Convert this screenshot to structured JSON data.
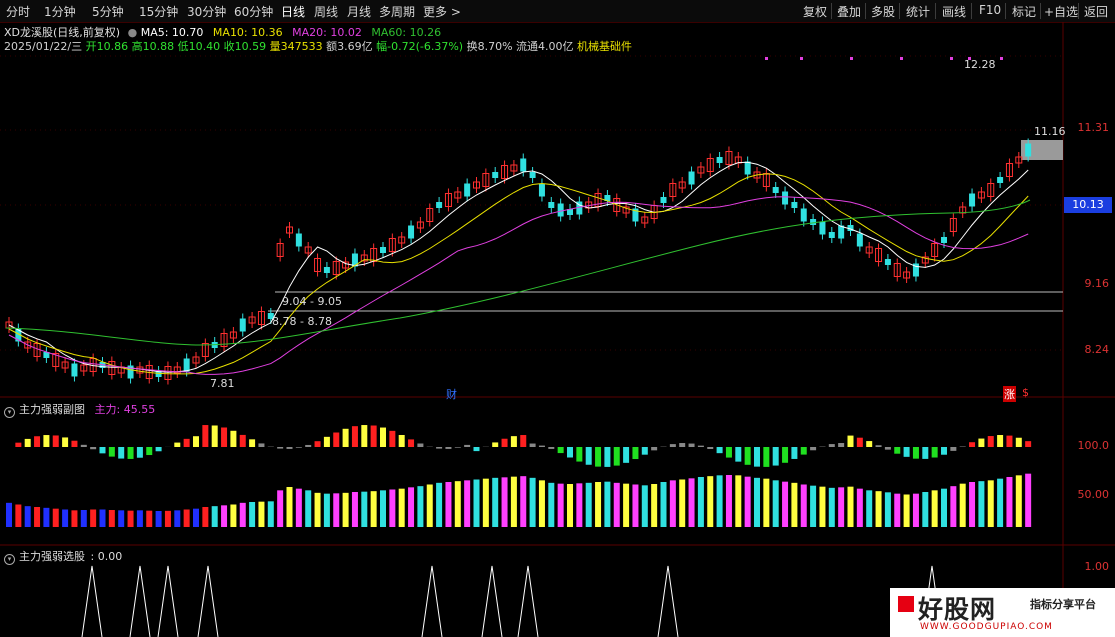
{
  "toolbar": {
    "left_items": [
      "分时",
      "1分钟",
      "5分钟",
      "15分钟",
      "30分钟",
      "60分钟",
      "日线",
      "周线",
      "月线",
      "多周期",
      "更多 >"
    ],
    "active": "日线",
    "right_items": [
      "复权",
      "叠加",
      "多股",
      "统计",
      "画线",
      "F10",
      "标记",
      "+自选",
      "返回"
    ]
  },
  "stock": {
    "title": "XD龙溪股(日线,前复权)",
    "ma5": "MA5: 10.70",
    "ma10": "MA10: 10.36",
    "ma20": "MA20: 10.02",
    "ma60": "MA60: 10.26",
    "date": "2025/01/22/三",
    "open": "开10.86",
    "high": "高10.88",
    "low": "低10.40",
    "close": "收10.59",
    "volume": "量347533",
    "amount": "额3.69亿",
    "change": "幅-0.72(-6.37%)",
    "turnover": "换8.70%",
    "float": "流通4.00亿",
    "sector": "机械基础件"
  },
  "price_axis": [
    "11.31",
    "10.13",
    "9.16",
    "8.24"
  ],
  "annotations": {
    "high_label": "12.28",
    "low_label": "7.81",
    "right_label": "11.16",
    "band1": "9.04 - 9.05",
    "band2": "8.78 - 8.78",
    "cai": "财",
    "zhang": "涨",
    "dollar": "$"
  },
  "current_price_tag": "10.13",
  "indicator1": {
    "title": "主力强弱副图",
    "value": "主力: 45.55",
    "axis": [
      "100.0",
      "50.00"
    ]
  },
  "indicator2": {
    "title": "主力强弱选股",
    "value": ": 0.00",
    "axis": [
      "1.00"
    ]
  },
  "colors": {
    "up": "#ff3030",
    "down": "#30e0e0",
    "ma5": "#ffffff",
    "ma10": "#e8e000",
    "ma20": "#e040e0",
    "ma60": "#30c030"
  },
  "watermark": {
    "main": "好股网",
    "sub": "指标分享平台",
    "url": "WWW.GOODGUPIAO.COM"
  }
}
